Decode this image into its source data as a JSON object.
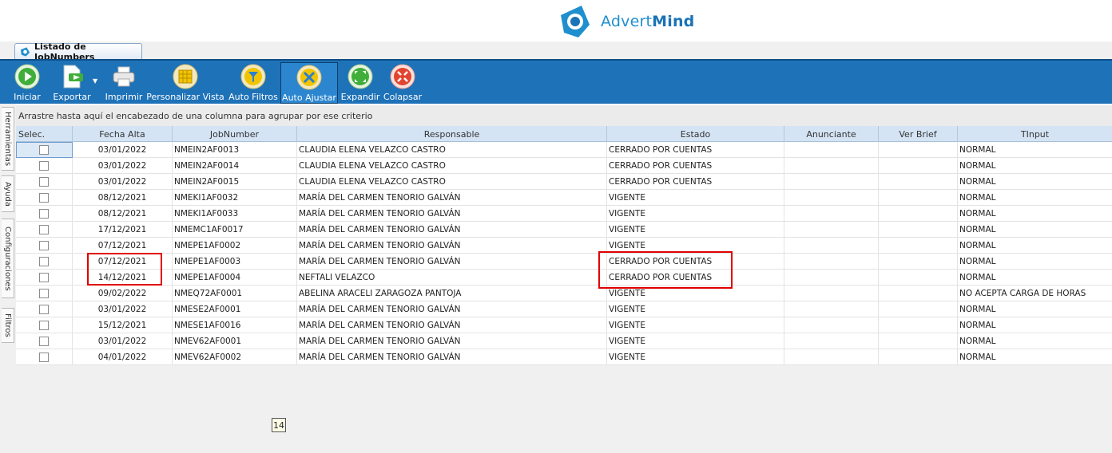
{
  "brand": {
    "name_light": "Advert",
    "name_bold": "Mind",
    "colors": {
      "primary": "#1f8fce",
      "toolbar": "#1e72b8"
    }
  },
  "tab": {
    "label": "Listado de JobNumbers",
    "icon": "app-logo-icon"
  },
  "toolbar": [
    {
      "label": "Iniciar",
      "icon": "play-icon"
    },
    {
      "label": "Exportar",
      "icon": "export-icon"
    },
    {
      "label": "Imprimir",
      "icon": "printer-icon"
    },
    {
      "label": "Personalizar Vista",
      "icon": "grid-view-icon"
    },
    {
      "label": "Auto Filtros",
      "icon": "filter-icon"
    },
    {
      "label": "Auto Ajustar",
      "icon": "auto-fit-icon"
    },
    {
      "label": "Expandir",
      "icon": "expand-icon"
    },
    {
      "label": "Colapsar",
      "icon": "collapse-icon"
    }
  ],
  "side_tabs": [
    "Herramientas",
    "Ayuda",
    "Configuraciones",
    "Filtros"
  ],
  "group_hint": "Arrastre hasta aquí el encabezado de una columna para agrupar por ese criterio",
  "columns": [
    "Selec.",
    "Fecha Alta",
    "JobNumber",
    "Responsable",
    "Estado",
    "Anunciante",
    "Ver Brief",
    "TInput"
  ],
  "rows": [
    {
      "fecha": "03/01/2022",
      "job": "NMEIN2AF0013",
      "resp": "CLAUDIA ELENA VELAZCO CASTRO",
      "estado": "CERRADO POR CUENTAS",
      "anunciante": "",
      "brief": "",
      "tinput": "NORMAL"
    },
    {
      "fecha": "03/01/2022",
      "job": "NMEIN2AF0014",
      "resp": "CLAUDIA ELENA VELAZCO CASTRO",
      "estado": "CERRADO POR CUENTAS",
      "anunciante": "",
      "brief": "",
      "tinput": "NORMAL"
    },
    {
      "fecha": "03/01/2022",
      "job": "NMEIN2AF0015",
      "resp": "CLAUDIA ELENA VELAZCO CASTRO",
      "estado": "CERRADO POR CUENTAS",
      "anunciante": "",
      "brief": "",
      "tinput": "NORMAL"
    },
    {
      "fecha": "08/12/2021",
      "job": "NMEKI1AF0032",
      "resp": "MARÍA DEL CARMEN TENORIO GALVÁN",
      "estado": "VIGENTE",
      "anunciante": "",
      "brief": "",
      "tinput": "NORMAL"
    },
    {
      "fecha": "08/12/2021",
      "job": "NMEKI1AF0033",
      "resp": "MARÍA DEL CARMEN TENORIO GALVÁN",
      "estado": "VIGENTE",
      "anunciante": "",
      "brief": "",
      "tinput": "NORMAL"
    },
    {
      "fecha": "17/12/2021",
      "job": "NMEMC1AF0017",
      "resp": "MARÍA DEL CARMEN TENORIO GALVÁN",
      "estado": "VIGENTE",
      "anunciante": "",
      "brief": "",
      "tinput": "NORMAL"
    },
    {
      "fecha": "07/12/2021",
      "job": "NMEPE1AF0002",
      "resp": "MARÍA DEL CARMEN TENORIO GALVÁN",
      "estado": "VIGENTE",
      "anunciante": "",
      "brief": "",
      "tinput": "NORMAL"
    },
    {
      "fecha": "07/12/2021",
      "job": "NMEPE1AF0003",
      "resp": "MARÍA DEL CARMEN TENORIO GALVÁN",
      "estado": "CERRADO POR CUENTAS",
      "anunciante": "",
      "brief": "",
      "tinput": "NORMAL"
    },
    {
      "fecha": "14/12/2021",
      "job": "NMEPE1AF0004",
      "resp": "NEFTALI VELAZCO",
      "estado": "CERRADO POR CUENTAS",
      "anunciante": "",
      "brief": "",
      "tinput": "NORMAL"
    },
    {
      "fecha": "09/02/2022",
      "job": "NMEQ72AF0001",
      "resp": "ABELINA ARACELI ZARAGOZA PANTOJA",
      "estado": "VIGENTE",
      "anunciante": "",
      "brief": "",
      "tinput": "NO ACEPTA CARGA DE HORAS"
    },
    {
      "fecha": "03/01/2022",
      "job": "NMESE2AF0001",
      "resp": "MARÍA DEL CARMEN TENORIO GALVÁN",
      "estado": "VIGENTE",
      "anunciante": "",
      "brief": "",
      "tinput": "NORMAL"
    },
    {
      "fecha": "15/12/2021",
      "job": "NMESE1AF0016",
      "resp": "MARÍA DEL CARMEN TENORIO GALVÁN",
      "estado": "VIGENTE",
      "anunciante": "",
      "brief": "",
      "tinput": "NORMAL"
    },
    {
      "fecha": "03/01/2022",
      "job": "NMEV62AF0001",
      "resp": "MARÍA DEL CARMEN TENORIO GALVÁN",
      "estado": "VIGENTE",
      "anunciante": "",
      "brief": "",
      "tinput": "NORMAL"
    },
    {
      "fecha": "04/01/2022",
      "job": "NMEV62AF0002",
      "resp": "MARÍA DEL CARMEN TENORIO GALVÁN",
      "estado": "VIGENTE",
      "anunciante": "",
      "brief": "",
      "tinput": "NORMAL"
    }
  ],
  "record_count": "14"
}
